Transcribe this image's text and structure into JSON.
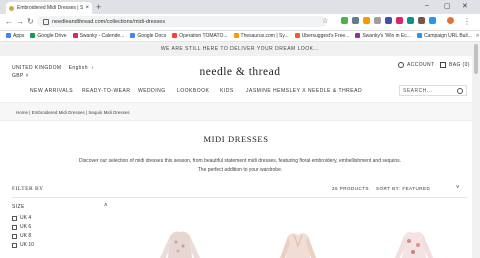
{
  "browser": {
    "tab_title": "Embroidered Midi Dresses | Sequin Midi Dresses...",
    "new_tab": "+",
    "url": "needleandthread.com/collections/midi-dresses",
    "bookmarks": [
      {
        "label": "Apps",
        "color": "#4285f4"
      },
      {
        "label": "Google Drive",
        "color": "#0f9d58"
      },
      {
        "label": "Swanky - Calende...",
        "color": "#e91e63"
      },
      {
        "label": "Google Docs",
        "color": "#4285f4"
      },
      {
        "label": "Operation TOMATO...",
        "color": "#f44336"
      },
      {
        "label": "Thesaurus.com | Sy...",
        "color": "#ff9800"
      },
      {
        "label": "Ubersuggest's Free...",
        "color": "#ff5722"
      },
      {
        "label": "Swanky's 'Win in Ec...",
        "color": "#9c27b0"
      },
      {
        "label": "Campaign URL Buil...",
        "color": "#2196f3"
      }
    ]
  },
  "site": {
    "announcement": "WE ARE STILL HERE TO DELIVER YOUR DREAM LOOK...",
    "country": "UNITED KINGDOM",
    "language": "English",
    "currency": "GBP",
    "logo": "needle & thread",
    "account": "ACCOUNT",
    "bag": "BAG (0)",
    "nav": [
      "NEW ARRIVALS",
      "READY-TO-WEAR",
      "WEDDING",
      "LOOKBOOK",
      "KIDS",
      "JASMINE HEMSLEY X NEEDLE & THREAD"
    ],
    "search_placeholder": "SEARCH...",
    "breadcrumb": "Home  |  Embroidered Midi Dresses | Sequin Midi Dresses",
    "page_title": "MIDI DRESSES",
    "description_1": "Discover our selection of midi dresses this season, from beautiful statement midi dresses, featuring floral embroidery, embellishment and sequins.",
    "description_2": "The perfect addition to your wardrobe.",
    "filter_by": "FILTER BY",
    "product_count": "26 PRODUCTS",
    "sort_by": "SORT BY:  FEATURED",
    "size_label": "SIZE",
    "sizes": [
      "UK 4",
      "UK 6",
      "UK 8",
      "UK 10"
    ]
  }
}
